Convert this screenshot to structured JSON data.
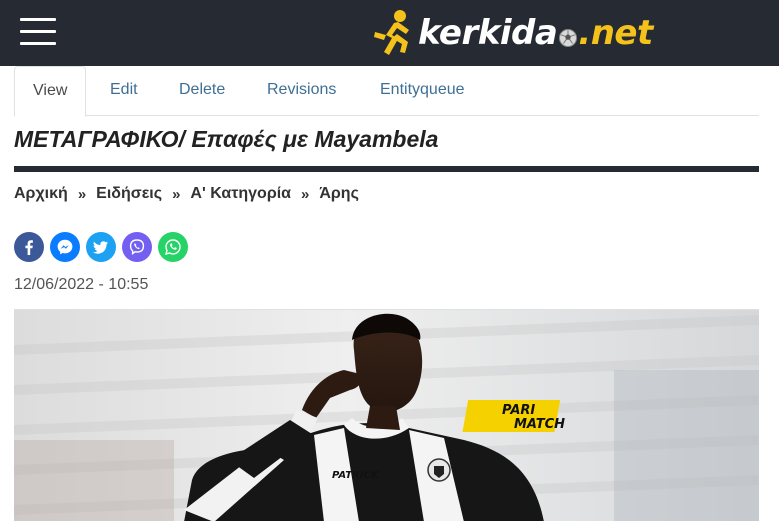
{
  "site": {
    "logo_word": "kerkida",
    "logo_net": ".net",
    "colors": {
      "header_bg": "#262b33",
      "brand_yellow": "#f4c21b",
      "link": "#3f6f94"
    }
  },
  "tabs": [
    {
      "label": "View",
      "active": true
    },
    {
      "label": "Edit"
    },
    {
      "label": "Delete"
    },
    {
      "label": "Revisions"
    },
    {
      "label": "Entityqueue"
    }
  ],
  "article": {
    "title": "ΜΕΤΑΓΡΑΦΙΚΟ/ Επαφές με Mayambela",
    "breadcrumb": [
      "Αρχική",
      "Ειδήσεις",
      "Α' Κατηγορία",
      "Άρης"
    ],
    "separator": "»",
    "date": "12/06/2022 - 10:55",
    "share_icons": [
      "facebook-icon",
      "messenger-icon",
      "twitter-icon",
      "viber-icon",
      "whatsapp-icon"
    ],
    "image": {
      "sponsor_line1": "PARI",
      "sponsor_line2": "MATCH",
      "kit_brand": "PATRICK"
    }
  }
}
